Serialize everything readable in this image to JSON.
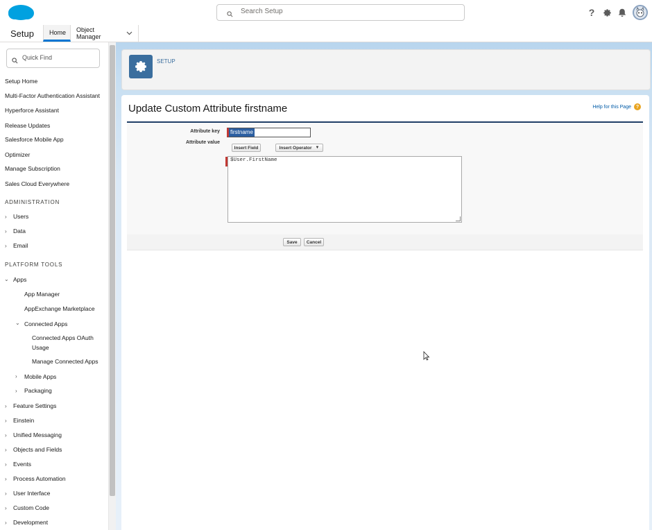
{
  "header": {
    "search_placeholder": "Search Setup",
    "icons": [
      "help-icon",
      "gear-icon",
      "bell-icon",
      "avatar"
    ]
  },
  "nav": {
    "app_title": "Setup",
    "tabs": [
      {
        "label": "Home",
        "active": true
      },
      {
        "label": "Object Manager",
        "dropdown": true
      }
    ]
  },
  "sidebar": {
    "quick_find_placeholder": "Quick Find",
    "top_items": [
      "Setup Home",
      "Multi-Factor Authentication Assistant",
      "Hyperforce Assistant",
      "Release Updates",
      "Salesforce Mobile App",
      "Optimizer",
      "Manage Subscription",
      "Sales Cloud Everywhere"
    ],
    "administration": {
      "title": "ADMINISTRATION",
      "items": [
        "Users",
        "Data",
        "Email"
      ]
    },
    "platform_tools": {
      "title": "PLATFORM TOOLS",
      "apps": "Apps",
      "app_manager": "App Manager",
      "appexchange": "AppExchange Marketplace",
      "connected_apps": "Connected Apps",
      "connected_apps_oauth_line1": "Connected Apps OAuth",
      "connected_apps_oauth_line2": "Usage",
      "manage_connected_apps": "Manage Connected Apps",
      "mobile_apps": "Mobile Apps",
      "packaging": "Packaging",
      "rest": [
        "Feature Settings",
        "Einstein",
        "Unified Messaging",
        "Objects and Fields",
        "Events",
        "Process Automation",
        "User Interface",
        "Custom Code",
        "Development"
      ]
    }
  },
  "main": {
    "breadcrumb": "SETUP",
    "page_title": "Update Custom Attribute firstname",
    "help_link": "Help for this Page",
    "form": {
      "key_label": "Attribute key",
      "key_value": "firstname",
      "value_label": "Attribute value",
      "insert_field": "Insert Field",
      "insert_operator": "Insert Operator",
      "value_text": "$User.FirstName",
      "save": "Save",
      "cancel": "Cancel"
    }
  },
  "colors": {
    "brand_blue": "#00a1e0",
    "accent": "#0176d3",
    "tile_blue": "#3b6e9e",
    "required_red": "#c23934"
  }
}
